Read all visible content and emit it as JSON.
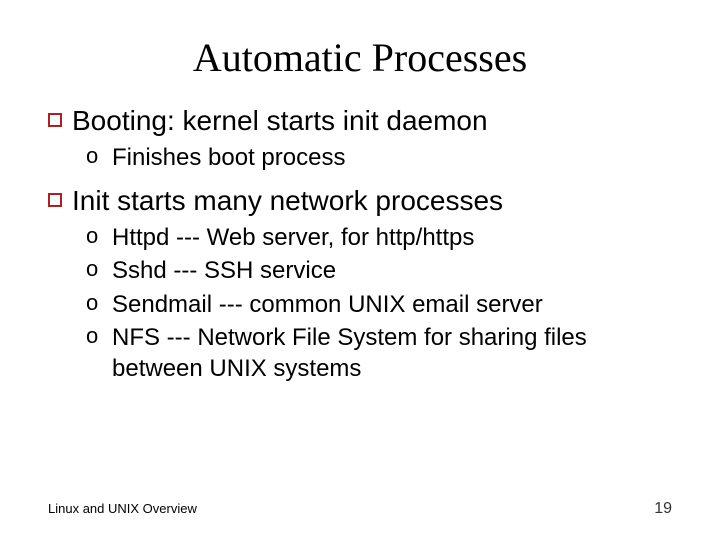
{
  "title": "Automatic Processes",
  "bullets": [
    {
      "text": "Booting: kernel starts init daemon",
      "sub": [
        "Finishes boot process"
      ]
    },
    {
      "text": "Init starts many network processes",
      "sub": [
        "Httpd --- Web server, for http/https",
        "Sshd --- SSH service",
        "Sendmail --- common UNIX email server",
        "NFS --- Network File System for sharing files between UNIX systems"
      ]
    }
  ],
  "footer": {
    "left": "Linux and UNIX Overview",
    "page": "19"
  }
}
